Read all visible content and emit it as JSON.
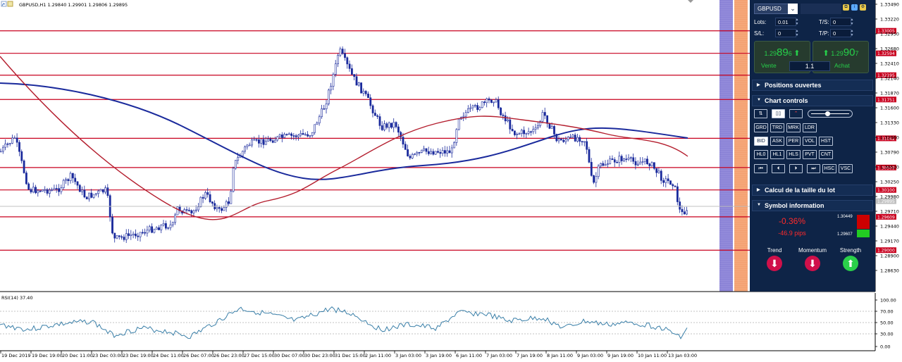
{
  "chart": {
    "symbol_header": "GBPUSD,H1  1.29840 1.29901 1.29806 1.29895",
    "price_axis": [
      "1.33490",
      "1.33220",
      "1.32950",
      "1.32680",
      "1.32410",
      "1.32140",
      "1.31870",
      "1.31600",
      "1.31330",
      "1.31060",
      "1.30790",
      "1.30520",
      "1.30250",
      "1.29980",
      "1.29710",
      "1.29440",
      "1.29170",
      "1.28900",
      "1.28630"
    ],
    "level_tags": [
      "1.33005",
      "1.32594",
      "1.32195",
      "1.31751",
      "1.31042",
      "1.30509",
      "1.30100",
      "1.29609",
      "1.29000"
    ],
    "current_price_tag": "1.29895",
    "time_axis": [
      "19 Dec 2019",
      "19 Dec 19:00",
      "20 Dec 11:00",
      "23 Dec 03:00",
      "23 Dec 19:00",
      "24 Dec 11:00",
      "26 Dec 07:00",
      "26 Dec 23:00",
      "27 Dec 15:00",
      "30 Dec 07:00",
      "30 Dec 23:00",
      "31 Dec 15:00",
      "2 Jan 11:00",
      "3 Jan 03:00",
      "3 Jan 19:00",
      "6 Jan 11:00",
      "7 Jan 03:00",
      "7 Jan 19:00",
      "8 Jan 11:00",
      "9 Jan 03:00",
      "9 Jan 19:00",
      "10 Jan 11:00",
      "13 Jan 03:00"
    ],
    "colors": {
      "candles": "#1a2a9c",
      "levels": "#c8001e",
      "ma_slow": "#1a2a9c",
      "ma_fast": "#b41e2e",
      "zone_purple": "#8a82d6",
      "zone_orange": "#f4a070"
    }
  },
  "rsi": {
    "label": "RSI(14) 37.40",
    "axis": [
      "100.00",
      "70.00",
      "50.00",
      "30.00",
      "0.00"
    ],
    "color": "#3a7fa8"
  },
  "panel": {
    "symbol": "GBPUSD",
    "lots_label": "Lots:",
    "lots_value": "0.01",
    "ts_label": "T/S:",
    "ts_value": "0",
    "sl_label": "S/L:",
    "sl_value": "0",
    "tp_label": "T/P:",
    "tp_value": "0",
    "sell_prefix": "1.29",
    "sell_big": "89",
    "sell_sup": "6",
    "buy_prefix": "1.29",
    "buy_big": "90",
    "buy_sup": "7",
    "sell_label": "Vente",
    "buy_label": "Achat",
    "lot_display": "1.1",
    "sections": {
      "open_positions": "Positions ouvertes",
      "chart_controls": "Chart controls",
      "lot_calc": "Calcul de la taille du lot",
      "symbol_info": "Symbol information"
    },
    "cc_row2": [
      "GRD",
      "TRD",
      "MRK",
      "LDR"
    ],
    "cc_row3": [
      "BID",
      "ASK",
      "PER",
      "VOL",
      "HST"
    ],
    "cc_row4": [
      "HL0",
      "HL1",
      "HLS",
      "PVT",
      "CNT"
    ],
    "cc_row5_last": [
      "HSC",
      "VSC"
    ],
    "change_pct": "-0.36%",
    "change_pips": "-46.9 pips",
    "high": "1.30449",
    "low": "1.29607",
    "trend_label": "Trend",
    "momentum_label": "Momentum",
    "strength_label": "Strength",
    "colors": {
      "bg": "#0e2447",
      "green": "#26d04a",
      "red": "#ff2a2a",
      "down_circle": "#d0104a",
      "up_circle": "#2ad04a"
    }
  }
}
